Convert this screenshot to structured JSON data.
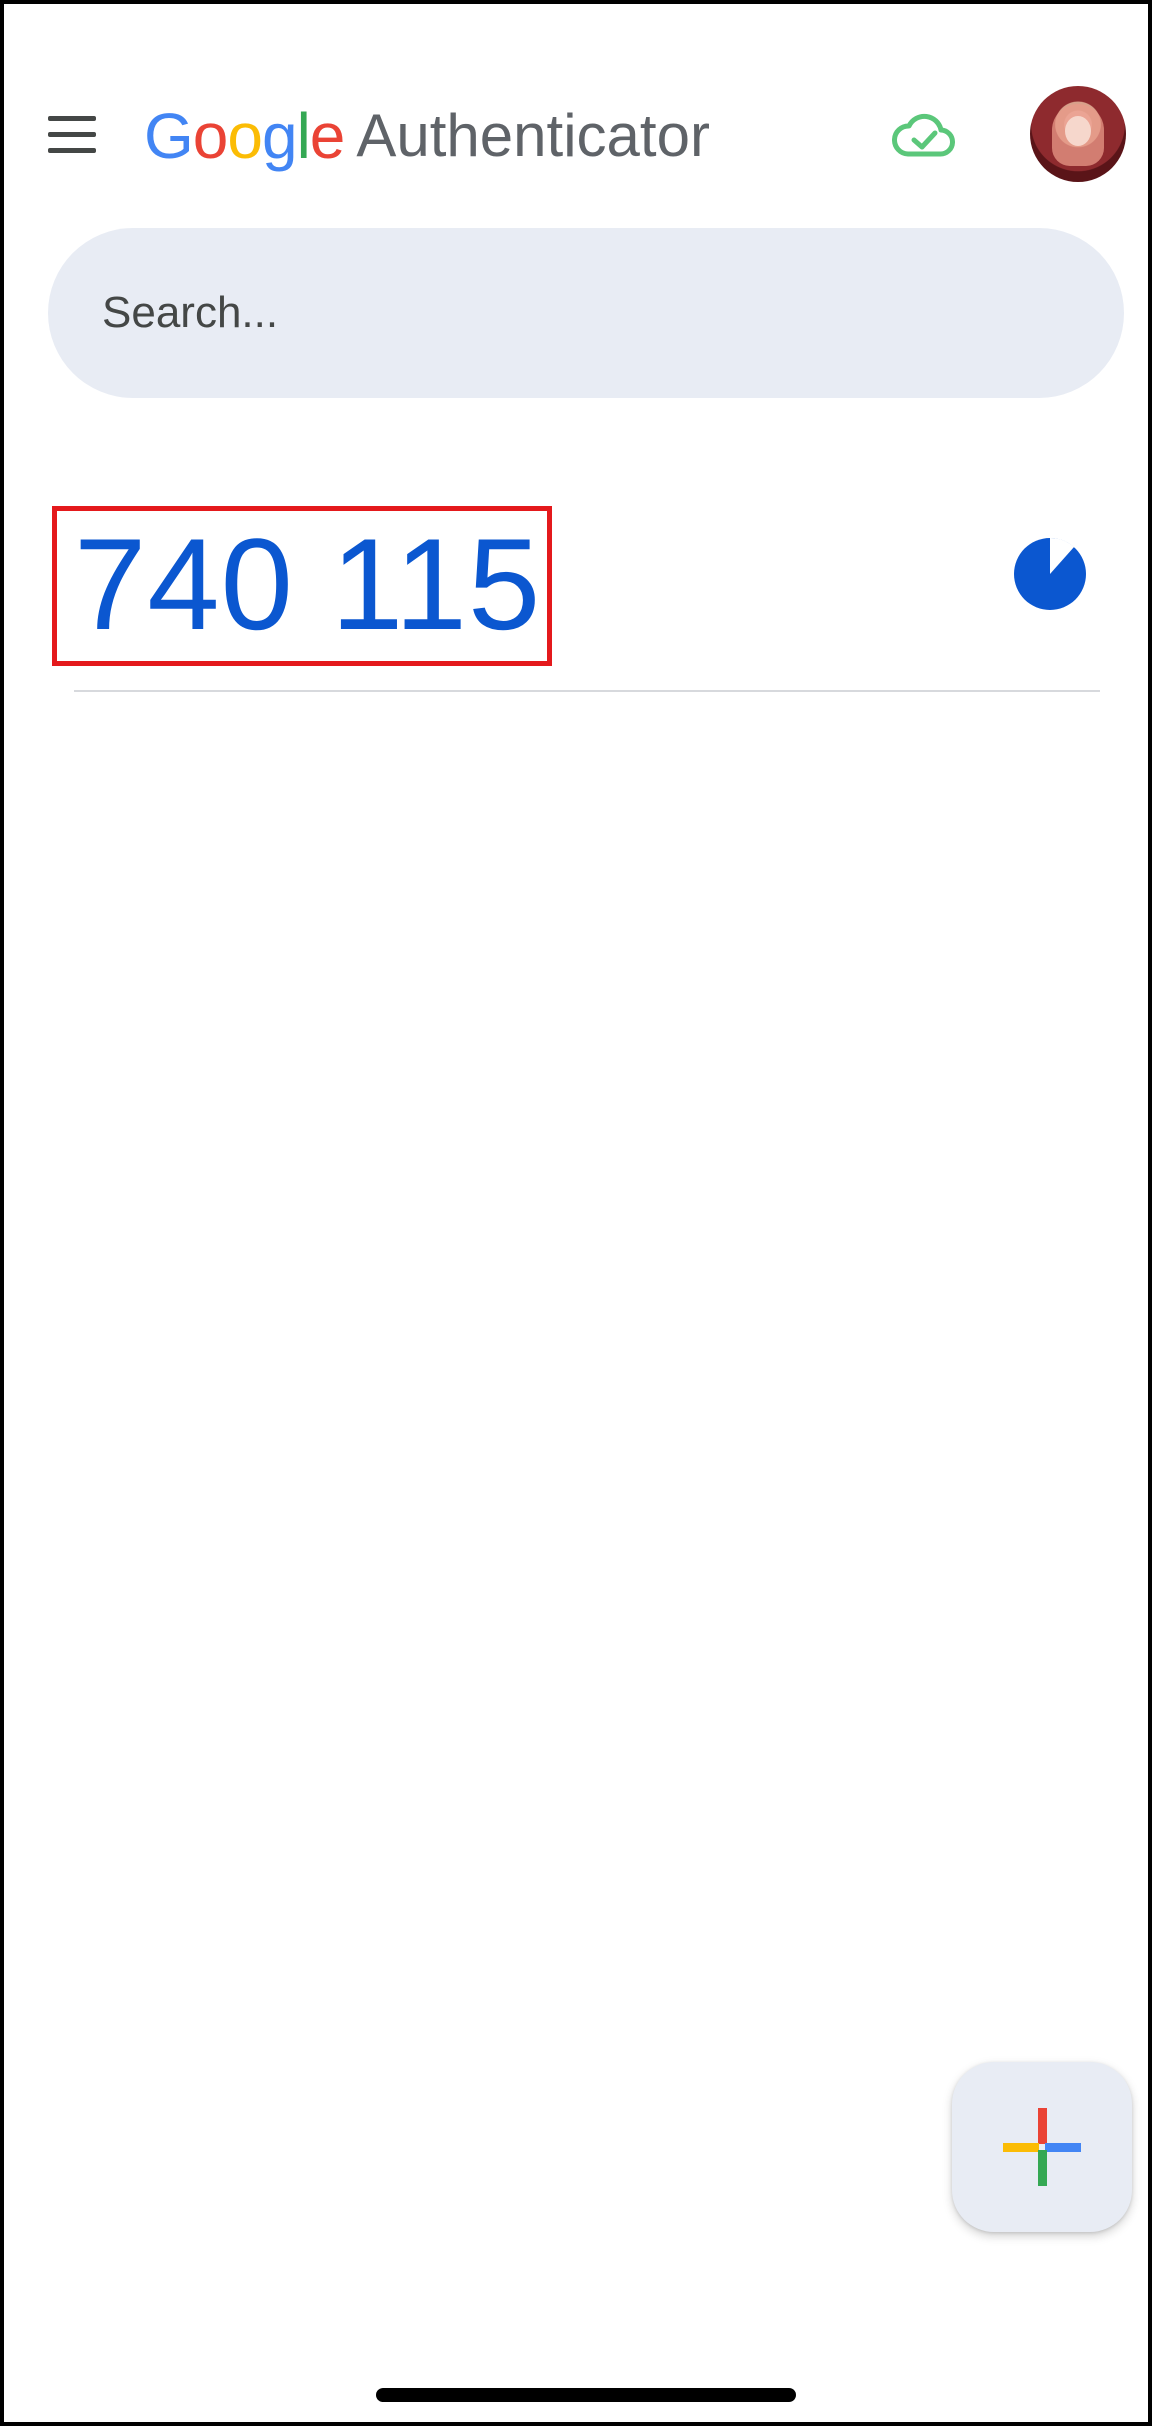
{
  "header": {
    "logo_letters": [
      {
        "char": "G",
        "color": "#4285F4"
      },
      {
        "char": "o",
        "color": "#EA4335"
      },
      {
        "char": "o",
        "color": "#FBBC05"
      },
      {
        "char": "g",
        "color": "#4285F4"
      },
      {
        "char": "l",
        "color": "#34A853"
      },
      {
        "char": "e",
        "color": "#EA4335"
      }
    ],
    "app_name": "Authenticator",
    "menu_icon": "hamburger-menu-icon",
    "sync_icon": "cloud-check-icon",
    "sync_color": "#5bc77a",
    "avatar_icon": "account-avatar"
  },
  "search": {
    "placeholder": "Search..."
  },
  "codes": [
    {
      "code": "740 115",
      "timer_icon": "countdown-timer-icon",
      "code_color": "#0b57d0"
    }
  ],
  "fab": {
    "icon": "add-plus-icon"
  },
  "colors": {
    "highlight_border": "#e4191c",
    "search_background": "#e8ecf4"
  }
}
